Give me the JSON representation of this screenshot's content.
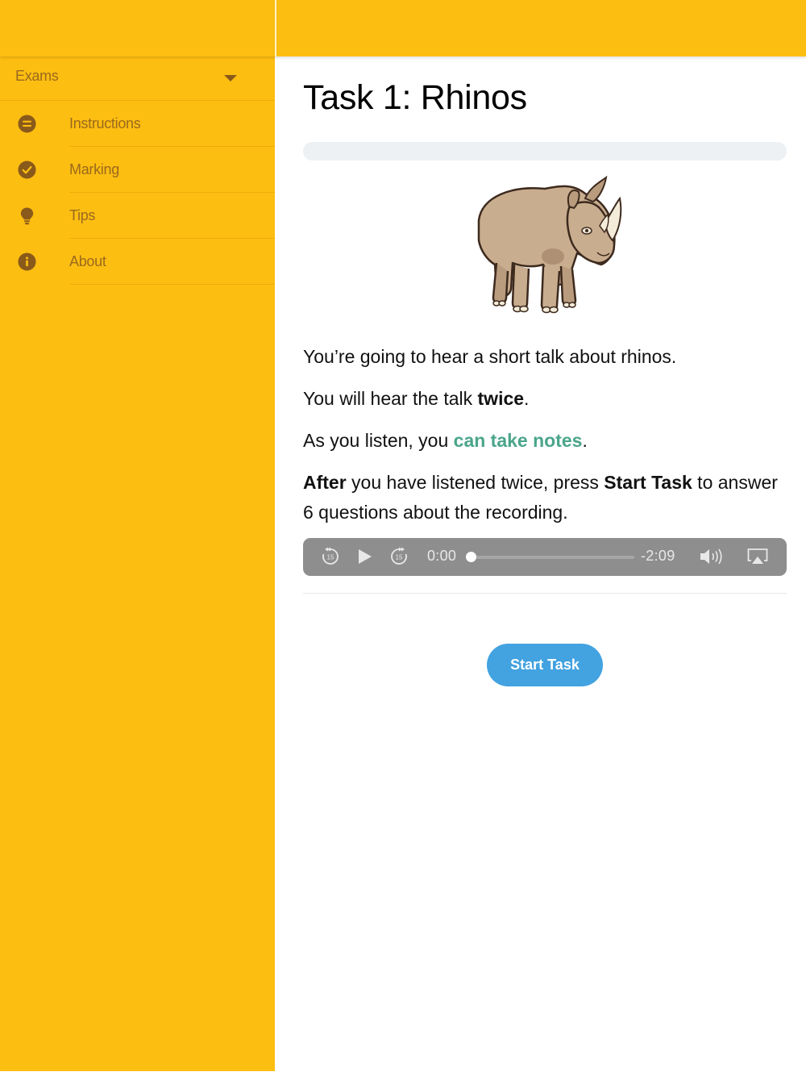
{
  "colors": {
    "sidebar_bg": "#fdbe12",
    "sidebar_text": "#9a6a1d",
    "accent_green": "#4aa58a",
    "button_blue": "#43a2e0",
    "player_gray": "#8e8e8e"
  },
  "sidebar": {
    "header_label": "Exams",
    "items": [
      {
        "label": "Instructions",
        "icon": "list-icon"
      },
      {
        "label": "Marking",
        "icon": "check-circle-icon"
      },
      {
        "label": "Tips",
        "icon": "lightbulb-icon"
      },
      {
        "label": "About",
        "icon": "info-icon"
      }
    ]
  },
  "main": {
    "title": "Task 1: Rhinos",
    "image": "rhino-illustration",
    "p1": "You’re going to hear a short talk about rhinos.",
    "p2_pre": "You will hear the talk ",
    "p2_bold": "twice",
    "p2_post": ".",
    "p3_pre": "As you listen, you ",
    "p3_highlight": "can take notes",
    "p3_post": ".",
    "p4_bold1": "After",
    "p4_mid": " you have listened twice, press ",
    "p4_bold2": "Start Task",
    "p4_post": " to answer 6 questions about the recording.",
    "audio": {
      "skip_back_label": "15",
      "skip_forward_label": "15",
      "elapsed": "0:00",
      "remaining": "-2:09",
      "progress": 0
    },
    "start_button": "Start Task"
  }
}
